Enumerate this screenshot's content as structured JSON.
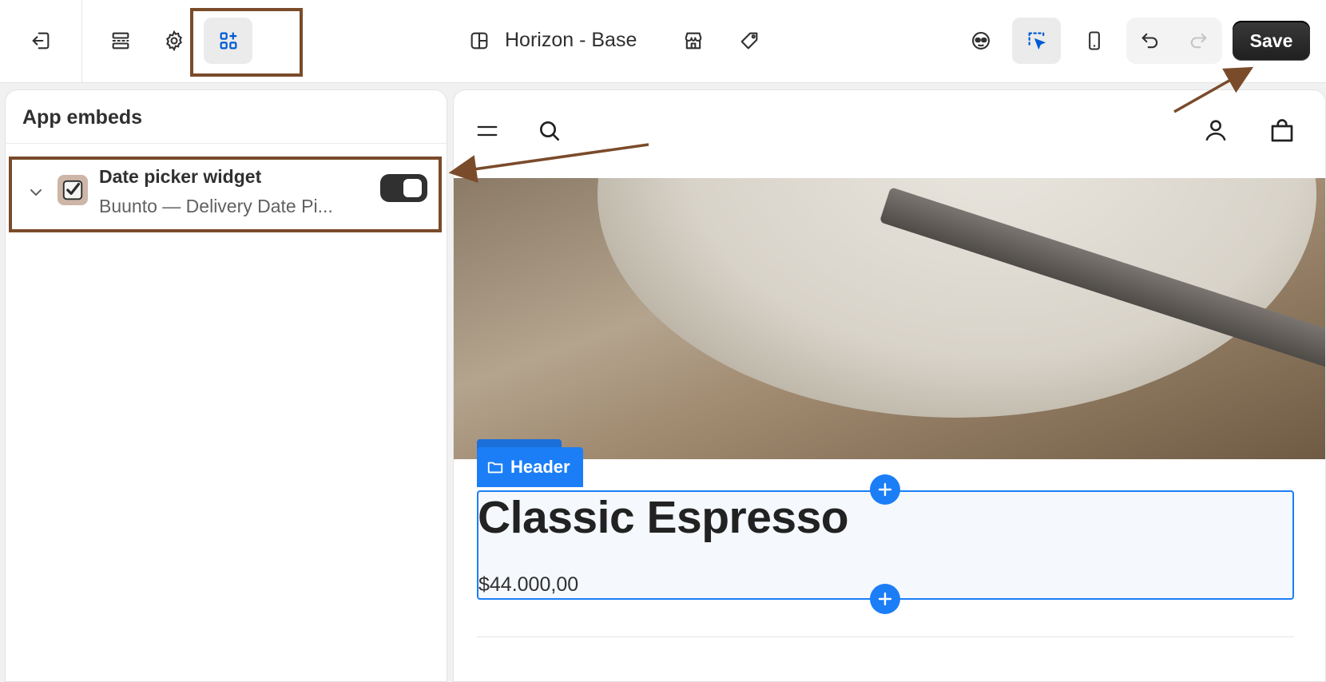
{
  "toolbar": {
    "theme_name": "Horizon - Base",
    "save_label": "Save",
    "icons": {
      "exit": "exit-icon",
      "sections": "sections-icon",
      "settings": "gear-icon",
      "app_embeds": "apps-add-icon",
      "layout": "layout-icon",
      "store": "store-icon",
      "tag": "tag-icon",
      "inspector": "inspector-icon",
      "select": "selection-cursor-icon",
      "mobile": "mobile-icon",
      "undo": "undo-icon",
      "redo": "redo-icon"
    },
    "accent_color": "#005bd3"
  },
  "sidebar": {
    "title": "App embeds",
    "embeds": [
      {
        "title": "Date picker widget",
        "subtitle": "Buunto — Delivery Date Pi...",
        "enabled": true
      }
    ]
  },
  "preview": {
    "section_label": "Header",
    "product_title": "Classic Espresso",
    "product_price": "$44.000,00",
    "selection_color": "#1b7ef7"
  },
  "annotations": {
    "color": "#7a4b2a"
  }
}
